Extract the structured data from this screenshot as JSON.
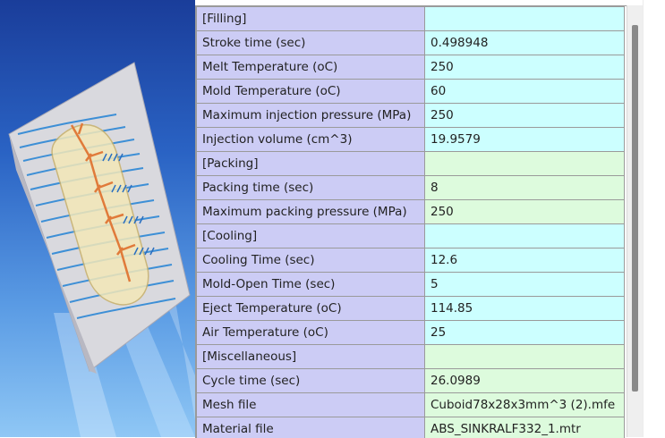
{
  "rows": [
    {
      "name": "[Filling]",
      "value": "",
      "color": "cyan"
    },
    {
      "name": "Stroke time (sec)",
      "value": "0.498948",
      "color": "cyan"
    },
    {
      "name": "Melt Temperature (oC)",
      "value": "250",
      "color": "cyan"
    },
    {
      "name": "Mold Temperature (oC)",
      "value": "60",
      "color": "cyan"
    },
    {
      "name": "Maximum injection pressure (MPa)",
      "value": "250",
      "color": "cyan"
    },
    {
      "name": "Injection volume (cm^3)",
      "value": "19.9579",
      "color": "cyan"
    },
    {
      "name": "[Packing]",
      "value": "",
      "color": "green"
    },
    {
      "name": "Packing time (sec)",
      "value": "8",
      "color": "green"
    },
    {
      "name": "Maximum packing pressure (MPa)",
      "value": "250",
      "color": "green"
    },
    {
      "name": "[Cooling]",
      "value": "",
      "color": "cyan"
    },
    {
      "name": "Cooling Time (sec)",
      "value": "12.6",
      "color": "cyan"
    },
    {
      "name": "Mold-Open Time (sec)",
      "value": "5",
      "color": "cyan"
    },
    {
      "name": "Eject Temperature (oC)",
      "value": "114.85",
      "color": "cyan"
    },
    {
      "name": "Air Temperature (oC)",
      "value": "25",
      "color": "cyan"
    },
    {
      "name": "[Miscellaneous]",
      "value": "",
      "color": "green"
    },
    {
      "name": "Cycle time (sec)",
      "value": "26.0989",
      "color": "green"
    },
    {
      "name": "Mesh file",
      "value": "Cuboid78x28x3mm^3 (2).mfe",
      "color": "green"
    },
    {
      "name": "Material file",
      "value": "ABS_SINKRALF332_1.mtr",
      "color": "green"
    }
  ],
  "colors": {
    "name_bg": "#ccccf5",
    "cyan_bg": "#ccffff",
    "green_bg": "#ddfbdd",
    "grid": "#9a9a9a"
  },
  "left_image_icon": "mold-part-illustration"
}
